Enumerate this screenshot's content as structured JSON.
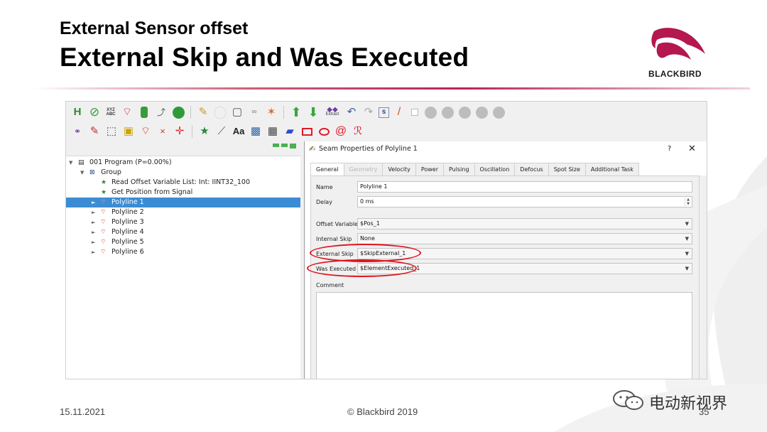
{
  "slide": {
    "subtitle": "External Sensor offset",
    "title": "External Skip and Was Executed",
    "logo_text": "BLACKBIRD",
    "date": "15.11.2021",
    "copyright": "© Blackbird 2019",
    "page_number": "35",
    "watermark_text": "电动新视界",
    "accent_color": "#b5174f"
  },
  "toolbar": {
    "row1_icons": [
      "save-icon",
      "validate-icon",
      "xyz-abc-icon",
      "laser-icon",
      "robot-icon",
      "path-icon",
      "play-icon",
      "pencil-icon",
      "circle-icon",
      "clipboard-icon",
      "link-icon",
      "star-icon",
      "arrow-up-icon",
      "arrow-down-icon",
      "extract-icon",
      "undo-icon",
      "redo-icon",
      "s-icon",
      "marker-icon",
      "checkbox-icon",
      "first-icon",
      "prev-icon",
      "play-media-icon",
      "next-icon",
      "last-icon"
    ],
    "row2_icons": [
      "chain-icon",
      "edit-icon",
      "select-icon",
      "cube-icon",
      "laser-small-icon",
      "x-icon",
      "crosshair-icon",
      "star-green-icon",
      "measure-icon",
      "text-icon",
      "image-icon",
      "pattern-icon",
      "polygon-icon",
      "rectangle-icon",
      "ellipse-icon",
      "spiral-icon",
      "wobble-icon"
    ],
    "extract_label": "Extract",
    "text_tool_label": "Aa",
    "s_label": "s"
  },
  "tree": {
    "items": [
      {
        "label": "001 Program (P=0.00%)",
        "icon": "program-icon",
        "expander": "▼",
        "selected": false
      },
      {
        "label": "Group",
        "icon": "group-icon",
        "expander": "▼",
        "selected": false
      },
      {
        "label": "Read Offset Variable List: Int: IINT32_100",
        "icon": "star-icon",
        "expander": "",
        "selected": false
      },
      {
        "label": "Get Position from Signal",
        "icon": "star-icon",
        "expander": "",
        "selected": false
      },
      {
        "label": "Polyline 1",
        "icon": "polyline-icon",
        "expander": "►",
        "selected": true
      },
      {
        "label": "Polyline 2",
        "icon": "polyline-icon",
        "expander": "►",
        "selected": false
      },
      {
        "label": "Polyline 3",
        "icon": "polyline-icon",
        "expander": "►",
        "selected": false
      },
      {
        "label": "Polyline 4",
        "icon": "polyline-icon",
        "expander": "►",
        "selected": false
      },
      {
        "label": "Polyline 5",
        "icon": "polyline-icon",
        "expander": "►",
        "selected": false
      },
      {
        "label": "Polyline 6",
        "icon": "polyline-icon",
        "expander": "►",
        "selected": false
      }
    ]
  },
  "dialog": {
    "title": "Seam Properties of Polyline 1",
    "help": "?",
    "close": "✕",
    "tabs": [
      {
        "label": "General",
        "active": true,
        "disabled": false
      },
      {
        "label": "Geometry",
        "active": false,
        "disabled": true
      },
      {
        "label": "Velocity",
        "active": false,
        "disabled": false
      },
      {
        "label": "Power",
        "active": false,
        "disabled": false
      },
      {
        "label": "Pulsing",
        "active": false,
        "disabled": false
      },
      {
        "label": "Oscillation",
        "active": false,
        "disabled": false
      },
      {
        "label": "Defocus",
        "active": false,
        "disabled": false
      },
      {
        "label": "Spot Size",
        "active": false,
        "disabled": false
      },
      {
        "label": "Additional Task",
        "active": false,
        "disabled": false
      }
    ],
    "fields": {
      "name_label": "Name",
      "name_value": "Polyline 1",
      "delay_label": "Delay",
      "delay_value": "0 ms",
      "offset_label": "Offset Variable",
      "offset_value": "$Pos_1",
      "internal_skip_label": "Internal Skip",
      "internal_skip_value": "None",
      "external_skip_label": "External Skip",
      "external_skip_value": "$SkipExternal_1",
      "was_executed_label": "Was Executed",
      "was_executed_value": "$ElementExecuted_1",
      "comment_label": "Comment"
    },
    "highlight_color": "#e0141e"
  }
}
